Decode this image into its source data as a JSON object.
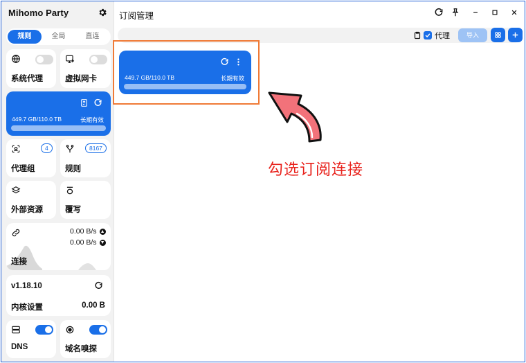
{
  "app": {
    "title": "Mihomo Party"
  },
  "sidebar": {
    "mode_tabs": [
      "规则",
      "全局",
      "直连"
    ],
    "active_mode": "规则",
    "system_proxy": {
      "label": "系统代理",
      "enabled": false
    },
    "tun": {
      "label": "虚拟网卡",
      "enabled": false
    },
    "subscription": {
      "traffic": "449.7 GB/110.0 TB",
      "expiry": "长期有效",
      "used_fraction": 0.004
    },
    "proxy_groups": {
      "label": "代理组",
      "count": "4"
    },
    "rules": {
      "label": "规则",
      "count": "8167"
    },
    "external_resources": {
      "label": "外部资源"
    },
    "override": {
      "label": "覆写"
    },
    "connections": {
      "label": "连接",
      "upload": "0.00 B/s",
      "download": "0.00 B/s"
    },
    "core": {
      "version": "v1.18.10",
      "label": "内核设置",
      "memory": "0.00 B"
    },
    "dns": {
      "label": "DNS",
      "enabled": true
    },
    "sniff": {
      "label": "域名嗅探",
      "enabled": true
    }
  },
  "main": {
    "title": "订阅管理",
    "proxy_checkbox_label": "代理",
    "proxy_checkbox_checked": true,
    "import_button": "导入",
    "subscription_card": {
      "traffic": "449.7 GB/110.0 TB",
      "expiry": "长期有效",
      "used_fraction": 0.004
    },
    "annotation": "勾选订阅连接"
  },
  "colors": {
    "accent": "#1a6fe8",
    "annotation": "#e8221c",
    "highlight_box": "#f07a36"
  },
  "icons": [
    "gear-icon",
    "globe-icon",
    "virtual-nic-icon",
    "document-icon",
    "refresh-icon",
    "proxy-group-icon",
    "fork-icon",
    "layers-icon",
    "override-icon",
    "link-icon",
    "upload-arrow-icon",
    "download-arrow-icon",
    "cpu-server-icon",
    "sniff-icon",
    "pin-icon",
    "minimize-icon",
    "maximize-icon",
    "close-icon",
    "more-vertical-icon",
    "grid-icon",
    "plus-icon"
  ]
}
